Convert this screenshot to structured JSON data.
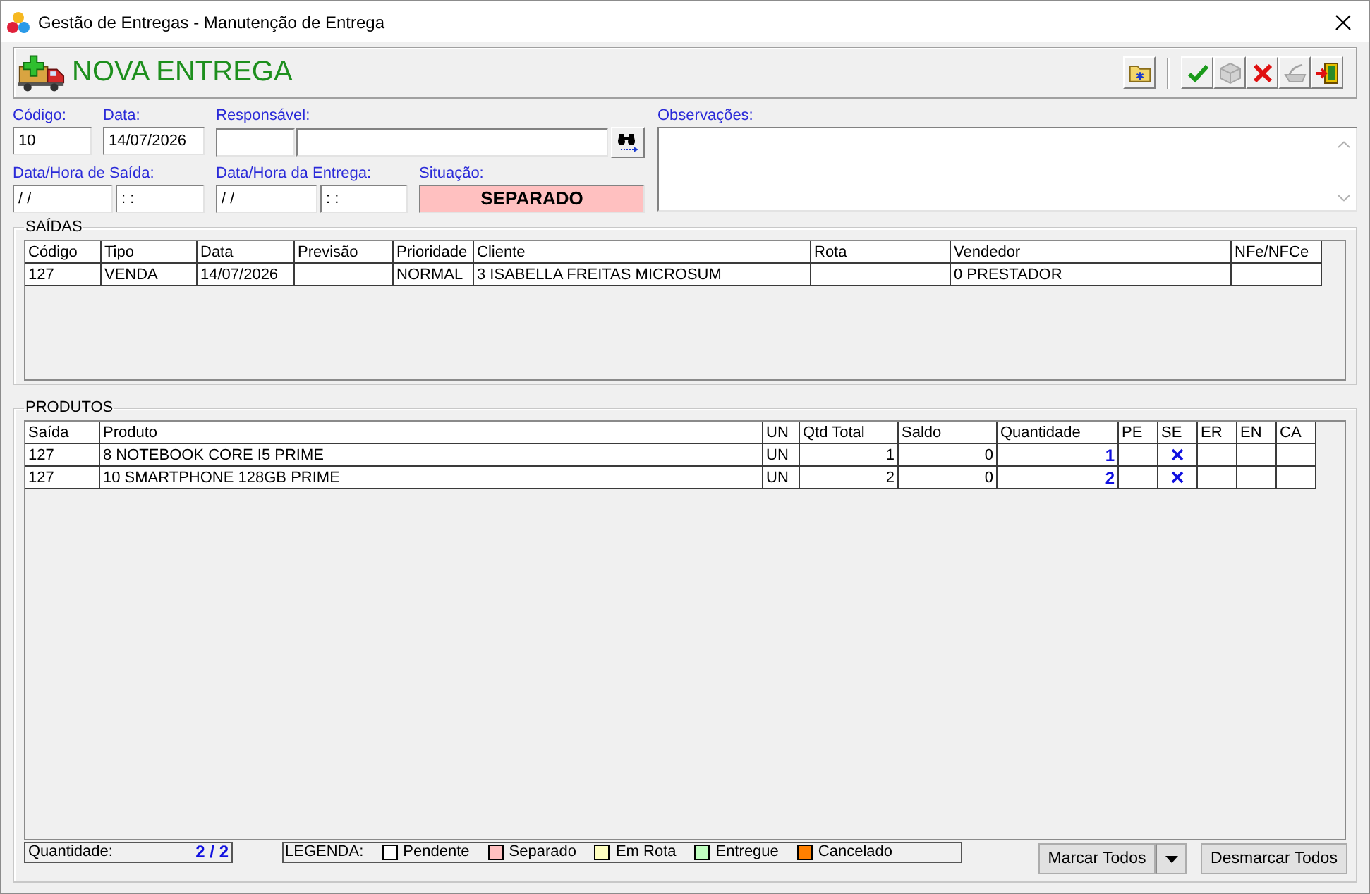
{
  "window": {
    "title": "Gestão de Entregas - Manutenção de Entrega"
  },
  "header": {
    "title": "NOVA ENTREGA",
    "toolbar_groups": [
      {
        "buttons": [
          {
            "kind": "folder",
            "disabled": false
          }
        ]
      },
      {
        "buttons": [
          {
            "kind": "confirm",
            "disabled": false
          },
          {
            "kind": "box",
            "disabled": true
          },
          {
            "kind": "cancel",
            "disabled": false
          },
          {
            "kind": "tray",
            "disabled": true
          },
          {
            "kind": "exit",
            "disabled": false
          }
        ]
      }
    ]
  },
  "form": {
    "codigo": {
      "label": "Código:",
      "value": "10"
    },
    "data": {
      "label": "Data:",
      "value": "14/07/2026"
    },
    "responsavel": {
      "label": "Responsável:"
    },
    "saida": {
      "label": "Data/Hora de Saída:",
      "date": "/ /",
      "time": ": :"
    },
    "entrega": {
      "label": "Data/Hora da Entrega:",
      "date": "/ /",
      "time": ": :"
    },
    "situacao": {
      "label": "Situação:",
      "value": "SEPARADO"
    },
    "observacoes": {
      "label": "Observações:"
    }
  },
  "saidas": {
    "title": "SAÍDAS",
    "columns": [
      "Código",
      "Tipo",
      "Data",
      "Previsão",
      "Prioridade",
      "Cliente",
      "Rota",
      "Vendedor",
      "NFe/NFCe"
    ],
    "rows": [
      [
        "127",
        "VENDA",
        "14/07/2026",
        null,
        "NORMAL",
        "3 ISABELLA FREITAS MICROSUM",
        null,
        "0 PRESTADOR",
        null
      ]
    ]
  },
  "produtos": {
    "title": "PRODUTOS",
    "columns": [
      {
        "label": "Saída",
        "kind": "text"
      },
      {
        "label": "Produto",
        "kind": "text"
      },
      {
        "label": "UN",
        "kind": "text"
      },
      {
        "label": "Qtd Total",
        "kind": "number"
      },
      {
        "label": "Saldo",
        "kind": "number"
      },
      {
        "label": "Quantidade",
        "kind": "quantity"
      },
      {
        "label": "PE",
        "kind": "flag"
      },
      {
        "label": "SE",
        "kind": "flag"
      },
      {
        "label": "ER",
        "kind": "flag"
      },
      {
        "label": "EN",
        "kind": "flag"
      },
      {
        "label": "CA",
        "kind": "flag"
      }
    ],
    "rows": [
      {
        "cells": [
          "127",
          "8 NOTEBOOK CORE I5 PRIME",
          "UN",
          "1",
          "0",
          "1"
        ],
        "flags": [
          {
            "checked": false
          },
          {
            "checked": true
          },
          {
            "checked": false
          },
          {
            "checked": false
          },
          {
            "checked": false
          }
        ]
      },
      {
        "cells": [
          "127",
          "10 SMARTPHONE 128GB PRIME",
          "UN",
          "2",
          "0",
          "2"
        ],
        "flags": [
          {
            "checked": false
          },
          {
            "checked": true
          },
          {
            "checked": false
          },
          {
            "checked": false
          },
          {
            "checked": false
          }
        ]
      }
    ]
  },
  "footer": {
    "quantidade": {
      "label": "Quantidade:",
      "value": "2 / 2"
    },
    "legend": {
      "label": "LEGENDA:",
      "items": [
        {
          "label": "Pendente",
          "color": "#ffffff"
        },
        {
          "label": "Separado",
          "color": "#ffc0c0"
        },
        {
          "label": "Em Rota",
          "color": "#ffffc0"
        },
        {
          "label": "Entregue",
          "color": "#c0ffc0"
        },
        {
          "label": "Cancelado",
          "color": "#ff8000"
        }
      ]
    },
    "buttons": [
      {
        "kind": "split",
        "label": "Marcar Todos"
      },
      {
        "kind": "plain",
        "label": "Desmarcar Todos"
      }
    ]
  }
}
